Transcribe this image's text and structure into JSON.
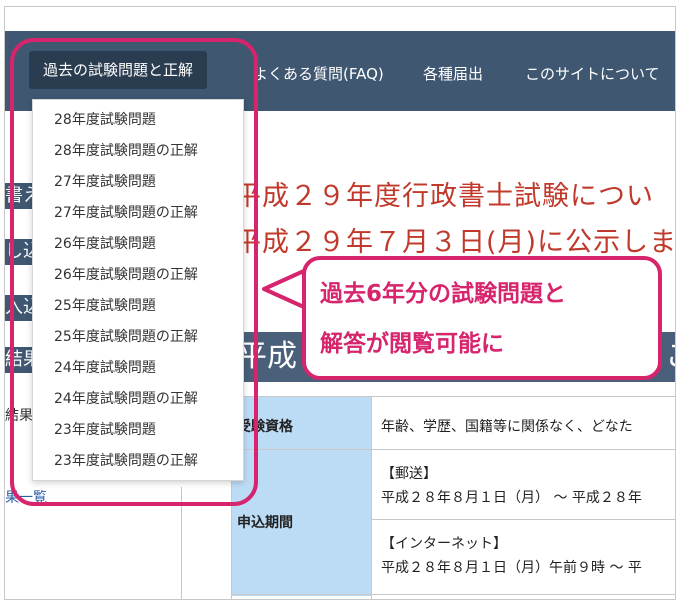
{
  "navbar": {
    "items": [
      {
        "label": "過去の試験問題と正解",
        "active": true
      },
      {
        "label": "よくある質問(FAQ)"
      },
      {
        "label": "各種届出"
      },
      {
        "label": "このサイトについて"
      }
    ]
  },
  "dropdown": {
    "items": [
      "28年度試験問題",
      "28年度試験問題の正解",
      "27年度試験問題",
      "27年度試験問題の正解",
      "26年度試験問題",
      "26年度試験問題の正解",
      "25年度試験問題",
      "25年度試験問題の正解",
      "24年度試験問題",
      "24年度試験問題の正解",
      "23年度試験問題",
      "23年度試験問題の正解"
    ]
  },
  "sidebar": {
    "buttons": [
      "書え",
      "し込",
      "入込",
      "結果"
    ],
    "text_1": "結果",
    "link": "果一覧"
  },
  "main": {
    "notice_line_1": "平成２９年度行政書士試験につい",
    "notice_line_2": "平成２９年７月３日(月)に公示しま",
    "banner_title": "平成",
    "banner_tail": "こ",
    "table": {
      "row1_head": "受験資格",
      "row1_value": "年齢、学歴、国籍等に関係なく、どなた",
      "row2_head": "申込期間",
      "row2_mail_label": "【郵送】",
      "row2_mail_value": "平成２８年８月１日（月） ～ 平成２８年",
      "row2_net_label": "【インターネット】",
      "row2_net_value": "平成２８年８月１日（月）午前９時 ～ 平"
    }
  },
  "annotation": {
    "line_1": "過去6年分の試験問題と",
    "line_2": "解答が閲覧可能に",
    "color": "#d6246d"
  },
  "colors": {
    "navbar": "#3f5771",
    "table_header": "#bcdcf6",
    "notice_text": "#c0392b"
  }
}
